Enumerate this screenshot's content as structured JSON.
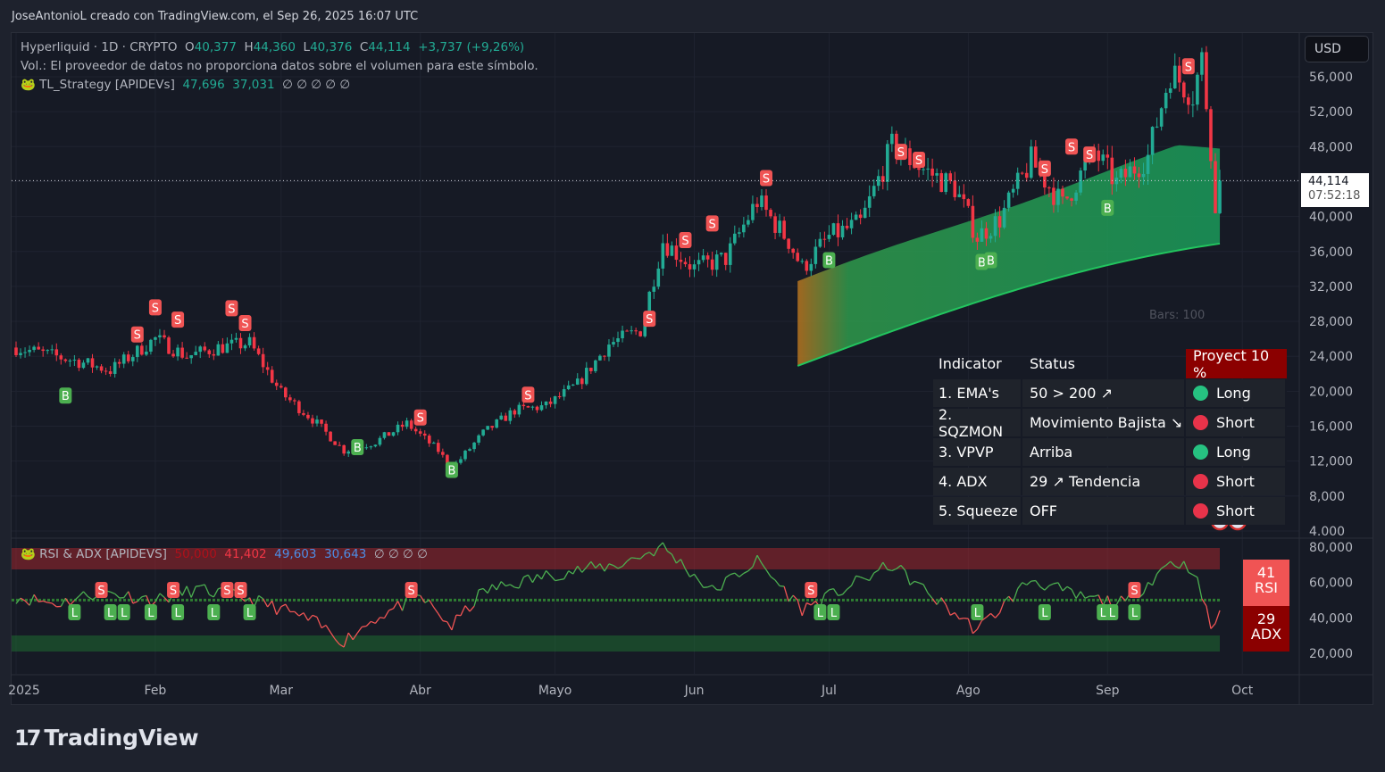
{
  "header": {
    "credit": "JoseAntonioL creado con TradingView.com, el Sep 26, 2025 16:07 UTC"
  },
  "legend": {
    "symbol": "Hyperliquid · 1D · CRYPTO",
    "o_label": "O",
    "o": "40,377",
    "h_label": "H",
    "h": "44,360",
    "l_label": "L",
    "l": "40,376",
    "c_label": "C",
    "c": "44,114",
    "change": "+3,737 (+9,26%)",
    "volume_note": "Vol.: El proveedor de datos no proporciona datos sobre el volumen para este símbolo.",
    "strategy": "TL_Strategy [APIDEVs]",
    "strategy_v1": "47,696",
    "strategy_v2": "37,031",
    "strategy_rest": "∅ ∅ ∅ ∅ ∅",
    "rsi_name": "RSI & ADX [APIDEVS]",
    "rsi_v0": "50,000",
    "rsi_v1": "41,402",
    "rsi_v2": "49,603",
    "rsi_v3": "30,643",
    "rsi_rest": "∅ ∅ ∅ ∅"
  },
  "currency": "USD",
  "last_price": {
    "value": "44,114",
    "countdown": "07:52:18"
  },
  "bars_label": "Bars: 100",
  "table": {
    "headers": [
      "Indicator",
      "Status",
      "Proyect 10 %"
    ],
    "rows": [
      {
        "indicator": "1. EMA's",
        "status": "50 > 200 ↗",
        "signal": "Long",
        "color": "#26c281"
      },
      {
        "indicator": "2. SQZMON",
        "status": "Movimiento Bajista ↘",
        "signal": "Short",
        "color": "#e8334a"
      },
      {
        "indicator": "3. VPVP",
        "status": "Arriba",
        "signal": "Long",
        "color": "#26c281"
      },
      {
        "indicator": "4. ADX",
        "status": "29 ↗ Tendencia",
        "signal": "Short",
        "color": "#e8334a"
      },
      {
        "indicator": "5. Squeeze",
        "status": "OFF",
        "signal": "Short",
        "color": "#e8334a"
      }
    ]
  },
  "rsi_box": {
    "value": "41",
    "label": "RSI"
  },
  "adx_box": {
    "value": "29",
    "label": "ADX"
  },
  "logo": "TradingView",
  "colors": {
    "up": "#22ab94",
    "down": "#f23645",
    "band": "#1a9a5a"
  },
  "chart_data": [
    {
      "type": "candlestick",
      "title": "Hyperliquid · 1D · CRYPTO",
      "ylim": [
        4000,
        58000
      ],
      "y_ticks": [
        "56,000",
        "52,000",
        "48,000",
        "44,000",
        "40,000",
        "36,000",
        "32,000",
        "28,000",
        "24,000",
        "20,000",
        "16,000",
        "12,000",
        "8,000",
        "4.000"
      ],
      "x_ticks": [
        {
          "label": "2025",
          "date": "01-01"
        },
        {
          "label": "Feb",
          "date": "02-01"
        },
        {
          "label": "Mar",
          "date": "03-01"
        },
        {
          "label": "Abr",
          "date": "04-01"
        },
        {
          "label": "Mayo",
          "date": "05-01"
        },
        {
          "label": "Jun",
          "date": "06-01"
        },
        {
          "label": "Jul",
          "date": "07-01"
        },
        {
          "label": "Ago",
          "date": "08-01"
        },
        {
          "label": "Sep",
          "date": "09-01"
        },
        {
          "label": "Oct",
          "date": "10-01"
        }
      ],
      "close_approx": [
        [
          "01-01",
          25000
        ],
        [
          "01-15",
          23400
        ],
        [
          "01-22",
          22400
        ],
        [
          "02-01",
          26000
        ],
        [
          "02-08",
          24000
        ],
        [
          "02-15",
          25000
        ],
        [
          "02-22",
          25500
        ],
        [
          "03-01",
          19800
        ],
        [
          "03-08",
          16800
        ],
        [
          "03-15",
          13200
        ],
        [
          "03-22",
          14200
        ],
        [
          "03-29",
          16300
        ],
        [
          "04-05",
          13200
        ],
        [
          "04-08",
          11100
        ],
        [
          "04-15",
          15200
        ],
        [
          "04-22",
          17800
        ],
        [
          "04-29",
          18300
        ],
        [
          "05-06",
          20800
        ],
        [
          "05-13",
          25400
        ],
        [
          "05-20",
          27000
        ],
        [
          "05-25",
          37200
        ],
        [
          "06-01",
          34100
        ],
        [
          "06-08",
          35200
        ],
        [
          "06-15",
          41800
        ],
        [
          "06-22",
          37200
        ],
        [
          "06-25",
          34100
        ],
        [
          "07-01",
          37700
        ],
        [
          "07-08",
          39200
        ],
        [
          "07-15",
          48000
        ],
        [
          "07-22",
          45400
        ],
        [
          "07-29",
          43300
        ],
        [
          "08-03",
          37700
        ],
        [
          "08-08",
          39700
        ],
        [
          "08-15",
          46400
        ],
        [
          "08-22",
          41300
        ],
        [
          "08-29",
          47400
        ],
        [
          "09-03",
          43800
        ],
        [
          "09-10",
          46900
        ],
        [
          "09-15",
          56600
        ],
        [
          "09-20",
          54000
        ],
        [
          "09-22",
          58000
        ],
        [
          "09-24",
          48000
        ],
        [
          "09-25",
          40377
        ],
        [
          "09-26",
          44114
        ]
      ],
      "band": {
        "start": [
          "06-24",
          32600,
          22900
        ],
        "end": [
          "09-26",
          47700,
          36900
        ]
      },
      "signals": [
        [
          "B",
          "01-12",
          19500
        ],
        [
          "S",
          "01-28",
          26500
        ],
        [
          "S",
          "02-01",
          29600
        ],
        [
          "S",
          "02-06",
          28200
        ],
        [
          "S",
          "02-18",
          29500
        ],
        [
          "S",
          "02-21",
          27800
        ],
        [
          "B",
          "03-18",
          13600
        ],
        [
          "S",
          "04-01",
          17000
        ],
        [
          "B",
          "04-08",
          11000
        ],
        [
          "S",
          "04-25",
          19600
        ],
        [
          "S",
          "05-22",
          28300
        ],
        [
          "S",
          "05-30",
          37300
        ],
        [
          "S",
          "06-05",
          39200
        ],
        [
          "S",
          "06-17",
          44400
        ],
        [
          "B",
          "07-01",
          35000
        ],
        [
          "S",
          "07-17",
          47400
        ],
        [
          "S",
          "07-21",
          46500
        ],
        [
          "B",
          "08-04",
          34800
        ],
        [
          "B",
          "08-06",
          35000
        ],
        [
          "S",
          "08-18",
          45500
        ],
        [
          "S",
          "08-24",
          48000
        ],
        [
          "S",
          "08-28",
          47100
        ],
        [
          "B",
          "09-01",
          41000
        ],
        [
          "S",
          "09-19",
          57200
        ]
      ]
    },
    {
      "type": "line",
      "title": "RSI & ADX [APIDEVS]",
      "ylim": [
        15,
        85
      ],
      "y_ticks": [
        "80,000",
        "60,000",
        "40,000",
        "20,000"
      ],
      "rsi_approx": [
        [
          "01-01",
          52
        ],
        [
          "01-10",
          48
        ],
        [
          "01-20",
          55
        ],
        [
          "02-01",
          50
        ],
        [
          "02-10",
          56
        ],
        [
          "02-20",
          52
        ],
        [
          "03-01",
          45
        ],
        [
          "03-08",
          38
        ],
        [
          "03-15",
          27
        ],
        [
          "03-22",
          40
        ],
        [
          "04-01",
          52
        ],
        [
          "04-08",
          35
        ],
        [
          "04-15",
          55
        ],
        [
          "05-01",
          65
        ],
        [
          "05-15",
          70
        ],
        [
          "05-25",
          80
        ],
        [
          "06-05",
          55
        ],
        [
          "06-15",
          72
        ],
        [
          "06-25",
          45
        ],
        [
          "07-01",
          52
        ],
        [
          "07-15",
          70
        ],
        [
          "07-25",
          50
        ],
        [
          "08-03",
          33
        ],
        [
          "08-15",
          62
        ],
        [
          "08-25",
          52
        ],
        [
          "09-05",
          48
        ],
        [
          "09-15",
          72
        ],
        [
          "09-20",
          68
        ],
        [
          "09-24",
          35
        ],
        [
          "09-26",
          41
        ]
      ],
      "signals": [
        [
          "L",
          "01-14"
        ],
        [
          "S",
          "01-20"
        ],
        [
          "L",
          "01-22"
        ],
        [
          "L",
          "01-25"
        ],
        [
          "L",
          "01-31"
        ],
        [
          "S",
          "02-05"
        ],
        [
          "L",
          "02-06"
        ],
        [
          "L",
          "02-14"
        ],
        [
          "S",
          "02-17"
        ],
        [
          "S",
          "02-20"
        ],
        [
          "L",
          "02-22"
        ],
        [
          "S",
          "03-30"
        ],
        [
          "L",
          "06-29"
        ],
        [
          "S",
          "06-27"
        ],
        [
          "L",
          "07-02"
        ],
        [
          "L",
          "08-03"
        ],
        [
          "L",
          "08-18"
        ],
        [
          "L",
          "08-31"
        ],
        [
          "L",
          "09-02"
        ],
        [
          "L",
          "09-07"
        ],
        [
          "S",
          "09-07"
        ]
      ]
    }
  ]
}
